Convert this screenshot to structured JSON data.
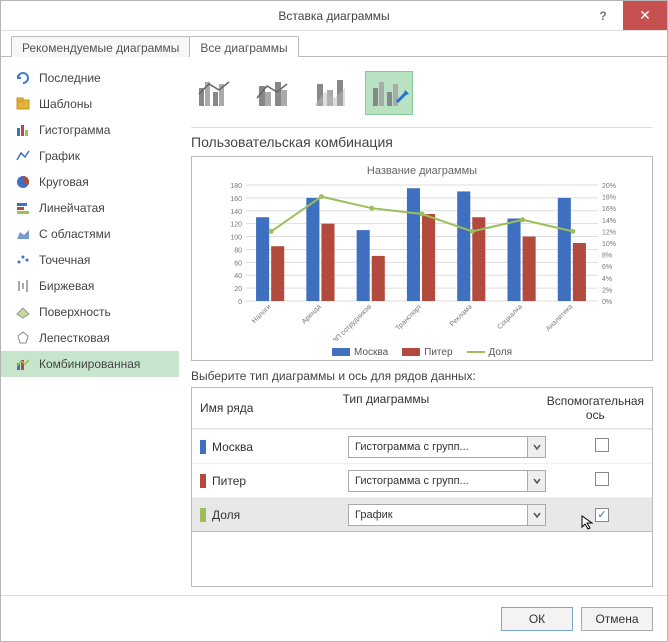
{
  "window": {
    "title": "Вставка диаграммы",
    "help_tooltip": "?",
    "close_label": "✕"
  },
  "tabs": [
    {
      "label": "Рекомендуемые диаграммы",
      "active": false
    },
    {
      "label": "Все диаграммы",
      "active": true
    }
  ],
  "sidebar": {
    "items": [
      {
        "label": "Последние",
        "icon": "recent-icon"
      },
      {
        "label": "Шаблоны",
        "icon": "templates-icon"
      },
      {
        "label": "Гистограмма",
        "icon": "bar-icon"
      },
      {
        "label": "График",
        "icon": "line-icon"
      },
      {
        "label": "Круговая",
        "icon": "pie-icon"
      },
      {
        "label": "Линейчатая",
        "icon": "hbar-icon"
      },
      {
        "label": "С областями",
        "icon": "area-icon"
      },
      {
        "label": "Точечная",
        "icon": "scatter-icon"
      },
      {
        "label": "Биржевая",
        "icon": "stock-icon"
      },
      {
        "label": "Поверхность",
        "icon": "surface-icon"
      },
      {
        "label": "Лепестковая",
        "icon": "radar-icon"
      },
      {
        "label": "Комбинированная",
        "icon": "combo-icon",
        "selected": true
      }
    ]
  },
  "chart_subtypes": {
    "selected_index": 3,
    "count": 4
  },
  "section_title": "Пользовательская комбинация",
  "preview": {
    "title": "Название диаграммы"
  },
  "series_table": {
    "header": {
      "name": "Имя ряда",
      "type": "Тип диаграммы",
      "axis": "Вспомогательная ось"
    },
    "label": "Выберите тип диаграммы и ось для рядов данных:",
    "rows": [
      {
        "name": "Москва",
        "color": "#3f6fbf",
        "type": "Гистограмма с групп...",
        "secondary": false
      },
      {
        "name": "Питер",
        "color": "#b24a3e",
        "type": "Гистограмма с групп...",
        "secondary": false
      },
      {
        "name": "Доля",
        "color": "#9cbf5a",
        "type": "График",
        "secondary": true,
        "selected": true
      }
    ]
  },
  "footer": {
    "ok": "ОК",
    "cancel": "Отмена"
  },
  "chart_data": {
    "type": "combo",
    "title": "Название диаграммы",
    "categories": [
      "Налоги",
      "Аренда",
      "ЗП сотрудников",
      "Транспорт",
      "Реклама",
      "Социалка",
      "Аналитика"
    ],
    "series": [
      {
        "name": "Москва",
        "type": "bar",
        "color": "#3f6fbf",
        "axis": "primary",
        "values": [
          130,
          160,
          110,
          175,
          170,
          128,
          160
        ]
      },
      {
        "name": "Питер",
        "type": "bar",
        "color": "#b24a3e",
        "axis": "primary",
        "values": [
          85,
          120,
          70,
          135,
          130,
          100,
          90
        ]
      },
      {
        "name": "Доля",
        "type": "line",
        "color": "#9cbf5a",
        "axis": "secondary",
        "values": [
          12,
          18,
          16,
          15,
          12,
          14,
          12
        ]
      }
    ],
    "ylim_primary": [
      0,
      180
    ],
    "yticks_primary": [
      0,
      20,
      40,
      60,
      80,
      100,
      120,
      140,
      160,
      180
    ],
    "ylim_secondary": [
      0,
      20
    ],
    "yticks_secondary": [
      "0%",
      "2%",
      "4%",
      "6%",
      "8%",
      "10%",
      "12%",
      "14%",
      "16%",
      "18%",
      "20%"
    ],
    "legend": [
      "Москва",
      "Питер",
      "Доля"
    ]
  }
}
